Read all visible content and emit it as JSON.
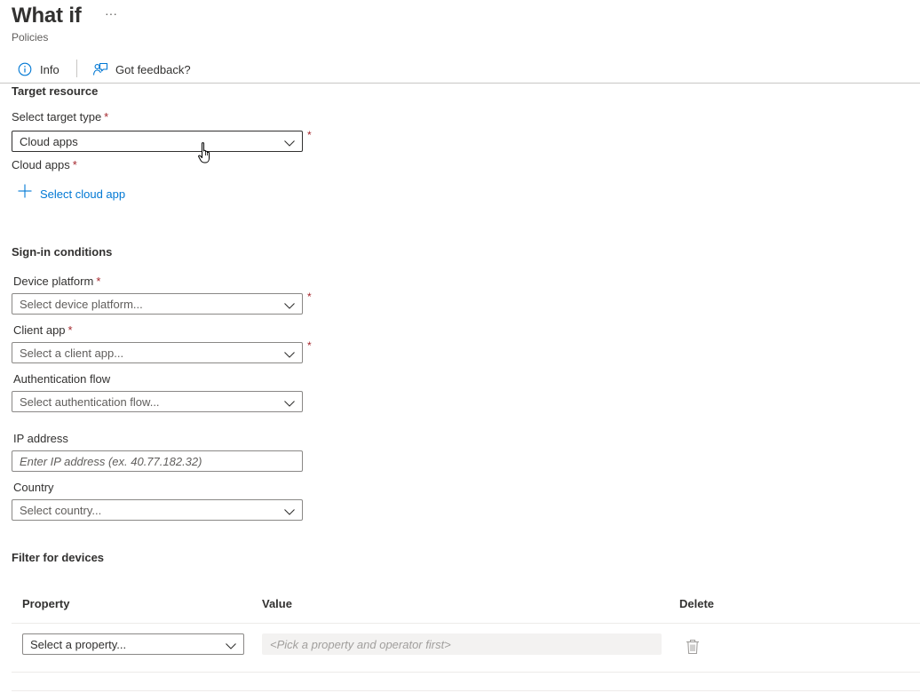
{
  "header": {
    "title": "What if",
    "more_label": "···",
    "subtitle": "Policies"
  },
  "toolbar": {
    "info_label": "Info",
    "feedback_label": "Got feedback?"
  },
  "target_resource": {
    "section_title": "Target resource",
    "target_type_label": "Select target type",
    "target_type_value": "Cloud apps",
    "cloud_apps_label": "Cloud apps",
    "select_cloud_app_label": "Select cloud app"
  },
  "sign_in_conditions": {
    "section_title": "Sign-in conditions",
    "device_platform_label": "Device platform",
    "device_platform_placeholder": "Select device platform...",
    "client_app_label": "Client app",
    "client_app_placeholder": "Select a client app...",
    "auth_flow_label": "Authentication flow",
    "auth_flow_placeholder": "Select authentication flow...",
    "ip_address_label": "IP address",
    "ip_address_placeholder": "Enter IP address (ex. 40.77.182.32)",
    "country_label": "Country",
    "country_placeholder": "Select country..."
  },
  "filter_for_devices": {
    "section_title": "Filter for devices",
    "columns": [
      "Property",
      "Value",
      "Delete"
    ],
    "rows": [
      {
        "property_placeholder": "Select a property...",
        "value_placeholder": "<Pick a property and operator first>"
      }
    ]
  },
  "required_marker": "*",
  "colors": {
    "accent": "#0078d4",
    "required": "#a4262c",
    "text": "#323130",
    "border": "#8a8886"
  },
  "icons": {
    "info": "info-icon",
    "feedback": "feedback-icon",
    "add": "plus-icon",
    "chevron": "chevron-down-icon",
    "delete": "trash-icon",
    "cursor": "hand-pointer-cursor-icon"
  }
}
